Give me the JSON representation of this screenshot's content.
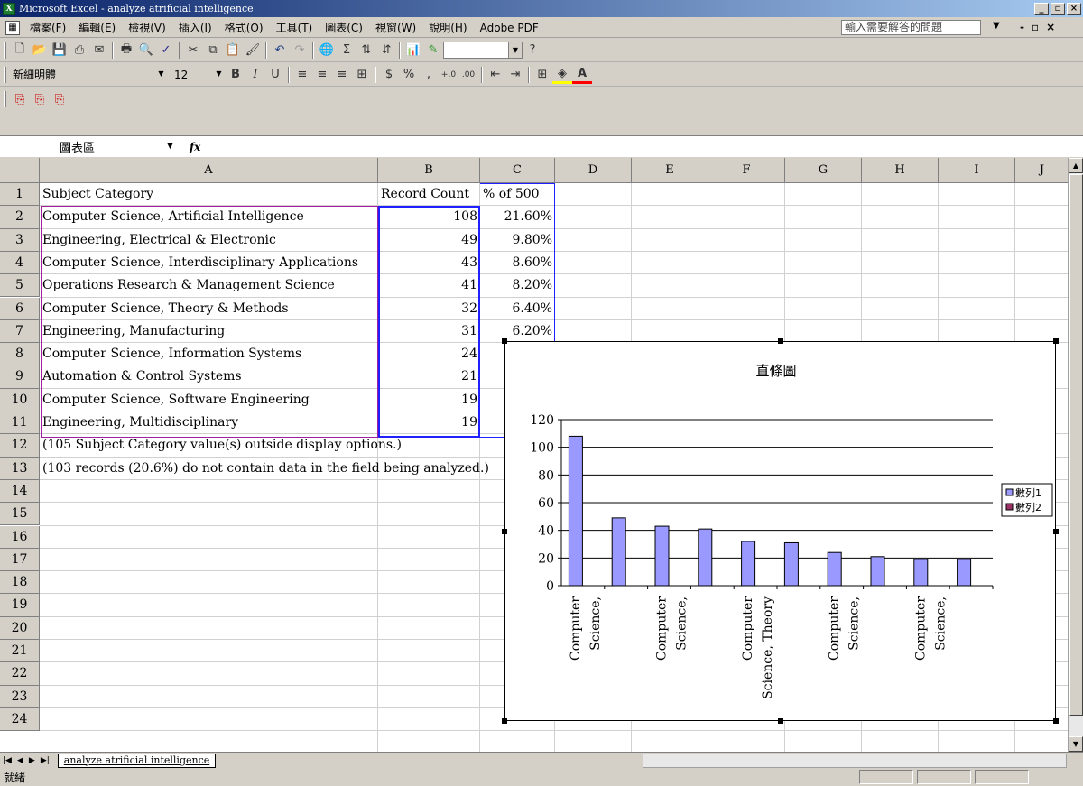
{
  "window": {
    "title": "Microsoft Excel - analyze atrificial intelligence",
    "min": "_",
    "max": "▫",
    "close": "×"
  },
  "menu": {
    "items": [
      "檔案(F)",
      "編輯(E)",
      "檢視(V)",
      "插入(I)",
      "格式(O)",
      "工具(T)",
      "圖表(C)",
      "視窗(W)",
      "說明(H)",
      "Adobe PDF"
    ],
    "help_placeholder": "輸入需要解答的問題"
  },
  "format_toolbar": {
    "font": "新細明體",
    "size": "12",
    "bold": "B",
    "italic": "I",
    "underline": "U",
    "currency": "$",
    "percent": "%",
    "comma": ","
  },
  "formula_bar": {
    "name_box": "圖表區",
    "fx": "fx"
  },
  "columns": [
    "A",
    "B",
    "C",
    "D",
    "E",
    "F",
    "G",
    "H",
    "I",
    "J"
  ],
  "rows": [
    "1",
    "2",
    "3",
    "4",
    "5",
    "6",
    "7",
    "8",
    "9",
    "10",
    "11",
    "12",
    "13",
    "14",
    "15",
    "16",
    "17",
    "18",
    "19",
    "20",
    "21",
    "22",
    "23",
    "24"
  ],
  "cells": {
    "header": {
      "a": "Subject Category",
      "b": "Record Count",
      "c": "% of 500"
    },
    "data": [
      {
        "a": "Computer Science, Artificial Intelligence",
        "b": "108",
        "c": "21.60%"
      },
      {
        "a": "Engineering, Electrical & Electronic",
        "b": "49",
        "c": "9.80%"
      },
      {
        "a": "Computer Science, Interdisciplinary Applications",
        "b": "43",
        "c": "8.60%"
      },
      {
        "a": "Operations Research & Management Science",
        "b": "41",
        "c": "8.20%"
      },
      {
        "a": "Computer Science, Theory & Methods",
        "b": "32",
        "c": "6.40%"
      },
      {
        "a": "Engineering, Manufacturing",
        "b": "31",
        "c": "6.20%"
      },
      {
        "a": "Computer Science, Information Systems",
        "b": "24",
        "c": ""
      },
      {
        "a": "Automation & Control Systems",
        "b": "21",
        "c": ""
      },
      {
        "a": "Computer Science, Software Engineering",
        "b": "19",
        "c": ""
      },
      {
        "a": "Engineering, Multidisciplinary",
        "b": "19",
        "c": ""
      }
    ],
    "note1": "(105 Subject Category value(s) outside display options.)",
    "note2": "(103 records (20.6%) do not contain data in the field being analyzed.)"
  },
  "chart_data": {
    "type": "bar",
    "title": "直條圖",
    "categories": [
      "Computer Science, Artificial Intelligence",
      "Engineering, Electrical & Electronic",
      "Computer Science, Interdisciplinary Applications",
      "Operations Research & Management Science",
      "Computer Science, Theory & Methods",
      "Engineering, Manufacturing",
      "Computer Science, Information Systems",
      "Automation & Control Systems",
      "Computer Science, Software Engineering",
      "Engineering, Multidisciplinary"
    ],
    "category_labels_shown": [
      [
        "Computer",
        "Science,"
      ],
      [
        "Computer",
        "Science,"
      ],
      [
        "Computer",
        "Science, Theory"
      ],
      [
        "Computer",
        "Science,"
      ],
      [
        "Computer",
        "Science,"
      ]
    ],
    "series": [
      {
        "name": "數列1",
        "values": [
          108,
          49,
          43,
          41,
          32,
          31,
          24,
          21,
          19,
          19
        ],
        "color": "#9999ff"
      },
      {
        "name": "數列2",
        "values": [],
        "color": "#993366"
      }
    ],
    "ylim": [
      0,
      120
    ],
    "yticks": [
      0,
      20,
      40,
      60,
      80,
      100,
      120
    ],
    "grid": true,
    "legend": "right"
  },
  "sheet_tab": "analyze atrificial intelligence",
  "status": "就緒"
}
